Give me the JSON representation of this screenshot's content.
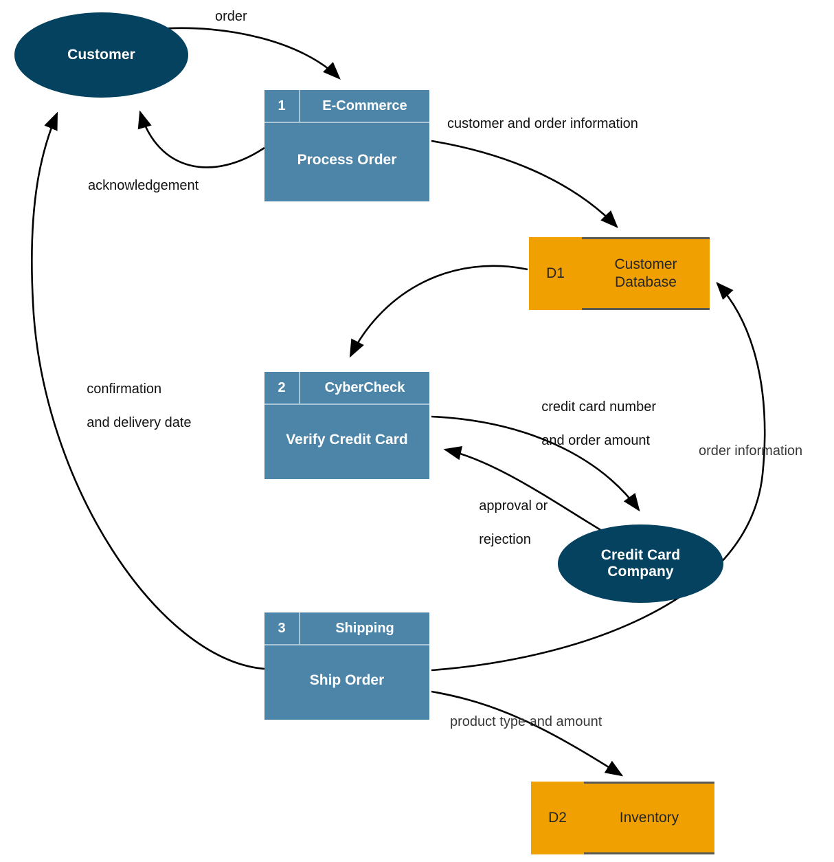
{
  "diagram": {
    "title": "E-Commerce Order Processing Data Flow Diagram",
    "colors": {
      "entity_fill": "#04425F",
      "process_fill": "#4D85A8",
      "process_divider": "#A9C6D6",
      "datastore_fill": "#F0A000",
      "datastore_rule": "#5A5A52",
      "flow_line": "#000000",
      "label_text": "#111111",
      "label_text_gray": "#383838",
      "canvas": "#FFFFFF"
    }
  },
  "entities": [
    {
      "id": "customer",
      "label": "Customer"
    },
    {
      "id": "credit-card-company",
      "label": "Credit Card\nCompany",
      "line1": "Credit Card",
      "line2": "Company"
    }
  ],
  "processes": [
    {
      "id": "process-1",
      "number": "1",
      "owner": "E-Commerce",
      "name": "Process Order"
    },
    {
      "id": "process-2",
      "number": "2",
      "owner": "CyberCheck",
      "name": "Verify Credit Card"
    },
    {
      "id": "process-3",
      "number": "3",
      "owner": "Shipping",
      "name": "Ship Order"
    }
  ],
  "datastores": [
    {
      "id": "d1",
      "number": "D1",
      "name": "Customer\nDatabase",
      "line1": "Customer",
      "line2": "Database"
    },
    {
      "id": "d2",
      "number": "D2",
      "name": "Inventory",
      "line1": "Inventory",
      "line2": ""
    }
  ],
  "flows": [
    {
      "id": "order",
      "label": "order",
      "from": "customer",
      "to": "process-1"
    },
    {
      "id": "acknowledgement",
      "label": "acknowledgement",
      "from": "process-1",
      "to": "customer"
    },
    {
      "id": "customer-and-order-information",
      "label": "customer and order information",
      "from": "process-1",
      "to": "d1"
    },
    {
      "id": "confirmation-and-delivery-date",
      "label": "confirmation\nand delivery date",
      "line1": "confirmation",
      "line2": "and delivery date",
      "from": "process-3",
      "to": "customer"
    },
    {
      "id": "credit-card-number-and-order-amount",
      "label": "credit card number\nand order amount",
      "line1": "credit card number",
      "line2": "and order amount",
      "from": "process-2",
      "to": "credit-card-company"
    },
    {
      "id": "approval-or-rejection",
      "label": "approval or\nrejection",
      "line1": "approval or",
      "line2": "rejection",
      "from": "credit-card-company",
      "to": "process-2"
    },
    {
      "id": "order-information",
      "label": "order information",
      "from": "process-3",
      "to": "d1"
    },
    {
      "id": "product-type-and-amount",
      "label": "product type and amount",
      "from": "process-3",
      "to": "d2"
    },
    {
      "id": "d1-to-process-2",
      "label": "",
      "from": "d1",
      "to": "process-2"
    }
  ]
}
